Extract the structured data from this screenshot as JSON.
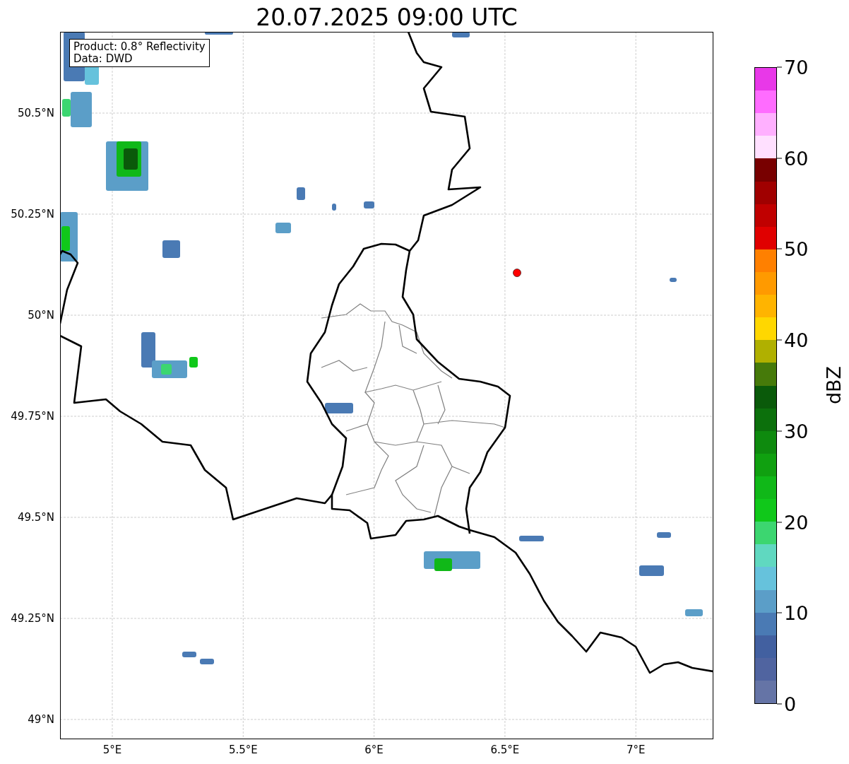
{
  "title": "20.07.2025 09:00 UTC",
  "info_box": {
    "lines": [
      "Product: 0.8° Reflectivity",
      "Data: DWD"
    ]
  },
  "map": {
    "lat_ticks": [
      "50.5°N",
      "50.25°N",
      "50°N",
      "49.75°N",
      "49.5°N",
      "49.25°N",
      "49°N"
    ],
    "lon_ticks": [
      "5°E",
      "5.5°E",
      "6°E",
      "6.5°E",
      "7°E"
    ]
  },
  "colorbar": {
    "label": "dBZ",
    "ticks": [
      "70",
      "60",
      "50",
      "40",
      "30",
      "20",
      "10",
      "0"
    ],
    "bins": [
      {
        "color": "#6574a6"
      },
      {
        "color": "#5064a0"
      },
      {
        "color": "#4260a0"
      },
      {
        "color": "#4a7ab4"
      },
      {
        "color": "#5b9ec8"
      },
      {
        "color": "#66c2dc"
      },
      {
        "color": "#60d8c0"
      },
      {
        "color": "#3cd670"
      },
      {
        "color": "#10c81a"
      },
      {
        "color": "#10b818"
      },
      {
        "color": "#10a010"
      },
      {
        "color": "#0e8a0e"
      },
      {
        "color": "#0c700c"
      },
      {
        "color": "#0a5a0a"
      },
      {
        "color": "#467a0a"
      },
      {
        "color": "#b0b000"
      },
      {
        "color": "#ffd700"
      },
      {
        "color": "#ffb400"
      },
      {
        "color": "#ff9a00"
      },
      {
        "color": "#ff8000"
      },
      {
        "color": "#e00000"
      },
      {
        "color": "#c00000"
      },
      {
        "color": "#a00000"
      },
      {
        "color": "#780000"
      },
      {
        "color": "#ffe0ff"
      },
      {
        "color": "#ffb0ff"
      },
      {
        "color": "#ff6cff"
      },
      {
        "color": "#e838e8"
      }
    ]
  }
}
